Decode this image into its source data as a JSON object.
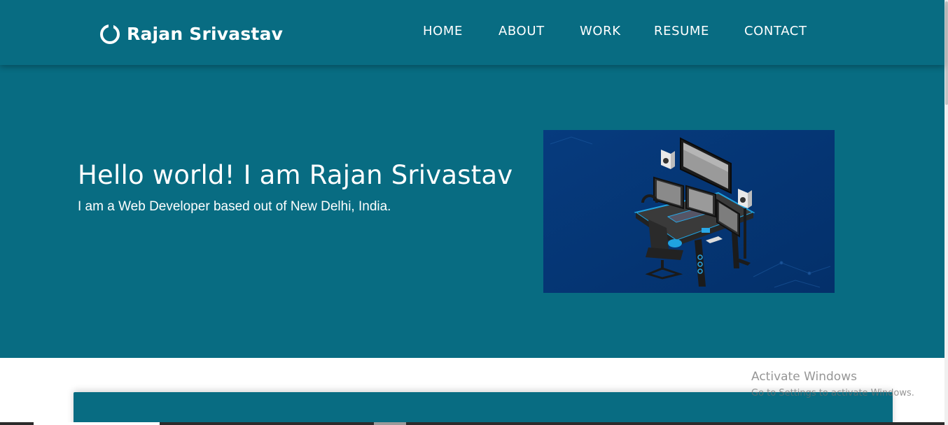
{
  "brand": {
    "name": "Rajan Srivastav",
    "icon": "ring-logo-icon"
  },
  "nav": {
    "items": [
      {
        "label": "HOME"
      },
      {
        "label": "ABOUT"
      },
      {
        "label": "WORK"
      },
      {
        "label": "RESUME"
      },
      {
        "label": "CONTACT"
      }
    ]
  },
  "hero": {
    "title": "Hello world! I am Rajan Srivastav",
    "subtitle": "I am a Web Developer based out of New Delhi, India.",
    "image_icon": "developer-workstation-illustration"
  },
  "watermark": {
    "title": "Activate Windows",
    "subtitle": "Go to Settings to activate Windows."
  },
  "colors": {
    "primary": "#086c82",
    "image_background": "#063a7a",
    "text": "#ffffff",
    "page_background": "#ffffff"
  }
}
